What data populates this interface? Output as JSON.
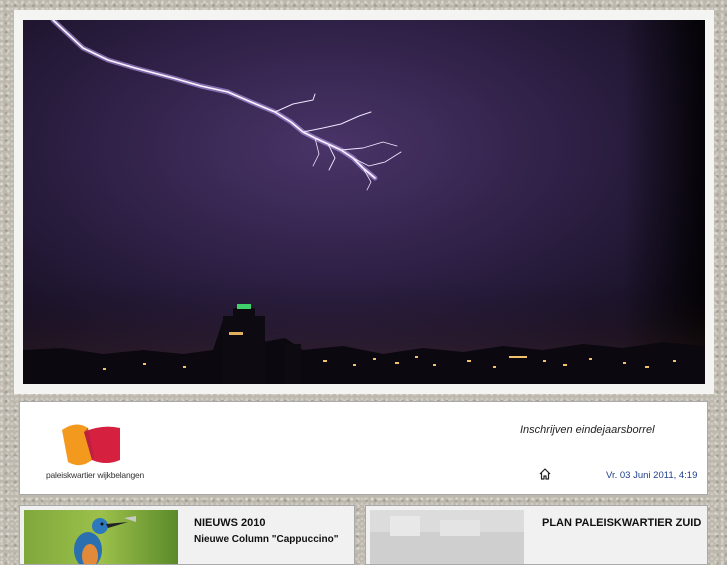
{
  "hero": {
    "alt": "lightning-over-city"
  },
  "header": {
    "logo_text": "paleiskwartier wijkbelangen",
    "signup_link": "Inschrijven eindejaarsborrel",
    "date": "Vr. 03 Juni 2011, 4:19",
    "colors": {
      "logo_orange": "#f39a1e",
      "logo_red": "#d5203f",
      "date_blue": "#1e3f8a"
    }
  },
  "cards": [
    {
      "title": "NIEUWS 2010",
      "subtitle": "Nieuwe Column \"Cappuccino\""
    },
    {
      "title": "PLAN PALEISKWARTIER ZUID"
    }
  ]
}
